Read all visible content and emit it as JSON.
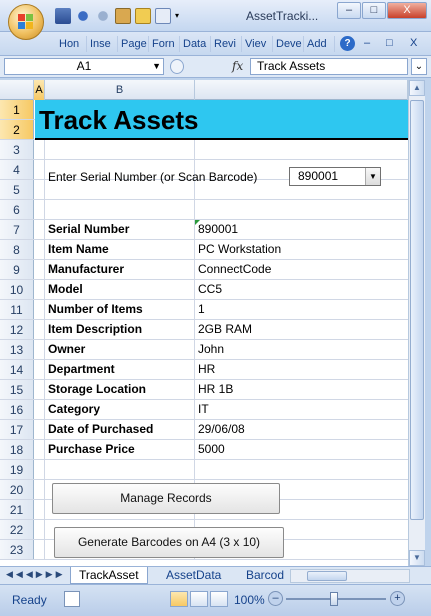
{
  "window": {
    "title": "AssetTracki...",
    "minimize": "–",
    "maximize": "□",
    "close": "X"
  },
  "ribbon": {
    "tabs": [
      "Hon",
      "Inse",
      "Page",
      "Forn",
      "Data",
      "Revi",
      "Viev",
      "Deve",
      "Add"
    ],
    "help": "?",
    "minimize": "–",
    "restore": "□",
    "close": "X"
  },
  "formula_bar": {
    "name_box": "A1",
    "fx": "fx",
    "content": "Track Assets"
  },
  "columns": [
    "A",
    "B"
  ],
  "rows": [
    "1",
    "2",
    "3",
    "4",
    "5",
    "6",
    "7",
    "8",
    "9",
    "10",
    "11",
    "12",
    "13",
    "14",
    "15",
    "16",
    "17",
    "18",
    "19",
    "20",
    "21",
    "22",
    "23"
  ],
  "sheet": {
    "banner_title": "Track Assets",
    "serial_prompt": "Enter Serial Number (or Scan Barcode)",
    "serial_selected": "890001",
    "records": [
      {
        "label": "Serial Number",
        "value": "890001"
      },
      {
        "label": "Item Name",
        "value": "PC Workstation"
      },
      {
        "label": "Manufacturer",
        "value": "ConnectCode"
      },
      {
        "label": "Model",
        "value": "CC5"
      },
      {
        "label": "Number of Items",
        "value": "1"
      },
      {
        "label": "Item Description",
        "value": "2GB RAM"
      },
      {
        "label": "Owner",
        "value": "John"
      },
      {
        "label": "Department",
        "value": "HR"
      },
      {
        "label": "Storage Location",
        "value": "HR 1B"
      },
      {
        "label": "Category",
        "value": "IT"
      },
      {
        "label": "Date of Purchased",
        "value": "29/06/08"
      },
      {
        "label": "Purchase Price",
        "value": "5000"
      }
    ],
    "manage_button": "Manage Records",
    "generate_button": "Generate Barcodes on A4 (3 x 10)"
  },
  "sheet_tabs": [
    "TrackAsset",
    "AssetData",
    "Barcod"
  ],
  "status": {
    "ready": "Ready",
    "zoom": "100%"
  },
  "colors": {
    "banner": "#2ec7f0",
    "selected_header": "#f7c964"
  }
}
